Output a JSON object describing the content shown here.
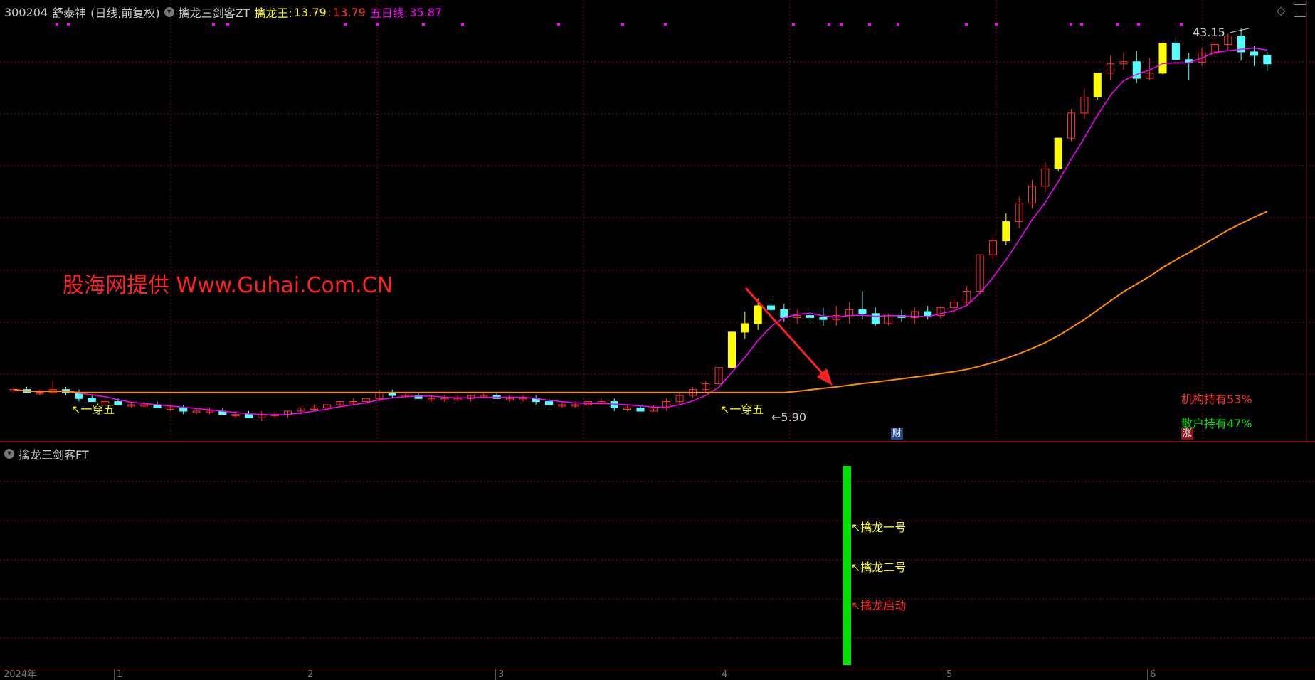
{
  "header": {
    "code": "300204",
    "name": "舒泰神",
    "period": "(日线,前复权)",
    "indicator": "擒龙三剑客ZT",
    "ind_label": "擒龙王:",
    "ind_value1": "13.79",
    "ind_value2": "13.79",
    "ma_label": "五日线:",
    "ma_value": "35.87"
  },
  "watermark": "股海网提供 Www.Guhai.Com.CN",
  "annotations": {
    "high_price": "43.15",
    "low_price": "5.90",
    "cross_five_1": "一穿五",
    "cross_five_2": "一穿五",
    "institution": "机构持有53%",
    "retail": "散户持有47%",
    "badge_fin": "财",
    "badge_up": "涨"
  },
  "sub_panel": {
    "title": "擒龙三剑客FT",
    "label1": "擒龙一号",
    "label2": "擒龙二号",
    "label3": "擒龙启动"
  },
  "time_axis": {
    "year": "2024年",
    "months": [
      "1",
      "2",
      "3",
      "4",
      "5",
      "6"
    ]
  },
  "colors": {
    "up": "#ff3333",
    "down": "#54ffff",
    "ma5": "#ff00ff",
    "long_ma": "#ff8c00",
    "signal_yellow": "#ffff00",
    "signal_green": "#00e000"
  },
  "chart_data": {
    "type": "candlestick",
    "price_high": 43.15,
    "price_low": 5.9,
    "candles": [
      [
        6.6,
        6.7,
        6.5,
        6.6
      ],
      [
        6.6,
        6.7,
        6.5,
        6.5
      ],
      [
        6.5,
        6.6,
        6.4,
        6.5
      ],
      [
        6.5,
        6.9,
        6.4,
        6.6
      ],
      [
        6.6,
        6.7,
        6.4,
        6.5
      ],
      [
        6.5,
        6.6,
        6.2,
        6.3
      ],
      [
        6.3,
        6.4,
        6.2,
        6.2
      ],
      [
        6.2,
        6.3,
        6.1,
        6.2
      ],
      [
        6.2,
        6.3,
        6.1,
        6.1
      ],
      [
        6.1,
        6.2,
        6.0,
        6.1
      ],
      [
        6.1,
        6.2,
        6.0,
        6.1
      ],
      [
        6.1,
        6.2,
        6.0,
        6.0
      ],
      [
        6.0,
        6.1,
        5.9,
        6.0
      ],
      [
        6.0,
        6.1,
        5.8,
        5.9
      ],
      [
        5.9,
        6.0,
        5.8,
        5.9
      ],
      [
        5.9,
        6.0,
        5.8,
        5.9
      ],
      [
        5.9,
        6.0,
        5.8,
        5.8
      ],
      [
        5.8,
        5.9,
        5.7,
        5.8
      ],
      [
        5.8,
        5.9,
        5.7,
        5.7
      ],
      [
        5.7,
        5.9,
        5.6,
        5.8
      ],
      [
        5.8,
        5.9,
        5.7,
        5.8
      ],
      [
        5.8,
        5.9,
        5.7,
        5.9
      ],
      [
        5.9,
        6.0,
        5.8,
        6.0
      ],
      [
        6.0,
        6.1,
        5.9,
        6.0
      ],
      [
        6.0,
        6.1,
        5.9,
        6.1
      ],
      [
        6.1,
        6.2,
        6.0,
        6.2
      ],
      [
        6.2,
        6.3,
        6.1,
        6.2
      ],
      [
        6.2,
        6.3,
        6.1,
        6.3
      ],
      [
        6.3,
        6.6,
        6.2,
        6.5
      ],
      [
        6.5,
        6.6,
        6.3,
        6.4
      ],
      [
        6.4,
        6.5,
        6.3,
        6.4
      ],
      [
        6.4,
        6.5,
        6.3,
        6.3
      ],
      [
        6.3,
        6.4,
        6.2,
        6.3
      ],
      [
        6.3,
        6.4,
        6.2,
        6.3
      ],
      [
        6.3,
        6.4,
        6.2,
        6.3
      ],
      [
        6.3,
        6.4,
        6.2,
        6.4
      ],
      [
        6.4,
        6.5,
        6.3,
        6.4
      ],
      [
        6.4,
        6.5,
        6.3,
        6.3
      ],
      [
        6.3,
        6.4,
        6.2,
        6.3
      ],
      [
        6.3,
        6.4,
        6.2,
        6.3
      ],
      [
        6.3,
        6.4,
        6.1,
        6.2
      ],
      [
        6.2,
        6.3,
        6.0,
        6.1
      ],
      [
        6.1,
        6.2,
        6.0,
        6.1
      ],
      [
        6.1,
        6.2,
        6.0,
        6.1
      ],
      [
        6.1,
        6.3,
        6.0,
        6.2
      ],
      [
        6.2,
        6.3,
        6.1,
        6.2
      ],
      [
        6.2,
        6.3,
        5.9,
        6.0
      ],
      [
        6.0,
        6.1,
        5.9,
        6.0
      ],
      [
        6.0,
        6.1,
        5.9,
        5.9
      ],
      [
        5.9,
        6.1,
        5.9,
        6.0
      ],
      [
        6.0,
        6.3,
        5.9,
        6.2
      ],
      [
        6.2,
        6.5,
        6.1,
        6.4
      ],
      [
        6.4,
        6.7,
        6.3,
        6.6
      ],
      [
        6.6,
        6.9,
        6.5,
        6.8
      ],
      [
        6.8,
        7.4,
        6.8,
        7.4
      ],
      [
        7.4,
        8.9,
        7.4,
        8.9
      ],
      [
        8.9,
        9.9,
        8.6,
        9.3
      ],
      [
        9.3,
        10.6,
        9.0,
        10.2
      ],
      [
        10.2,
        10.6,
        9.7,
        10.0
      ],
      [
        10.0,
        10.3,
        9.4,
        9.6
      ],
      [
        9.6,
        10.0,
        9.3,
        9.7
      ],
      [
        9.7,
        10.0,
        9.3,
        9.6
      ],
      [
        9.6,
        10.1,
        9.2,
        9.5
      ],
      [
        9.5,
        10.2,
        9.2,
        9.7
      ],
      [
        9.7,
        10.4,
        9.3,
        10.0
      ],
      [
        10.0,
        11.0,
        9.5,
        9.8
      ],
      [
        9.8,
        10.1,
        9.2,
        9.3
      ],
      [
        9.3,
        9.8,
        9.2,
        9.7
      ],
      [
        9.7,
        10.0,
        9.4,
        9.6
      ],
      [
        9.6,
        10.1,
        9.3,
        9.9
      ],
      [
        9.9,
        10.2,
        9.5,
        9.7
      ],
      [
        9.7,
        10.2,
        9.5,
        10.1
      ],
      [
        10.1,
        10.6,
        9.8,
        10.4
      ],
      [
        10.4,
        11.3,
        10.2,
        11.0
      ],
      [
        11.0,
        13.3,
        10.9,
        13.3
      ],
      [
        13.3,
        14.8,
        13.0,
        14.3
      ],
      [
        14.3,
        16.5,
        14.0,
        15.8
      ],
      [
        15.8,
        18.0,
        15.3,
        17.4
      ],
      [
        17.4,
        19.6,
        16.9,
        19.0
      ],
      [
        19.0,
        21.5,
        18.4,
        20.8
      ],
      [
        20.8,
        24.4,
        20.5,
        24.4
      ],
      [
        24.4,
        28.4,
        24.0,
        27.8
      ],
      [
        27.8,
        31.5,
        27.0,
        30.2
      ],
      [
        30.2,
        34.2,
        29.8,
        34.2
      ],
      [
        34.2,
        37.5,
        33.0,
        35.9
      ],
      [
        35.9,
        38.0,
        34.8,
        36.3
      ],
      [
        36.3,
        38.3,
        32.5,
        33.3
      ],
      [
        33.3,
        37.0,
        33.0,
        34.2
      ],
      [
        34.2,
        40.0,
        34.0,
        40.0
      ],
      [
        40.0,
        41.0,
        37.2,
        36.7
      ],
      [
        36.7,
        38.0,
        33.0,
        36.2
      ],
      [
        36.2,
        39.0,
        35.5,
        38.0
      ],
      [
        38.0,
        41.2,
        37.5,
        39.7
      ],
      [
        39.7,
        42.0,
        38.6,
        41.5
      ],
      [
        41.5,
        43.15,
        36.5,
        38.2
      ],
      [
        38.2,
        39.5,
        35.5,
        37.5
      ],
      [
        37.5,
        38.2,
        34.6,
        35.9
      ]
    ]
  }
}
